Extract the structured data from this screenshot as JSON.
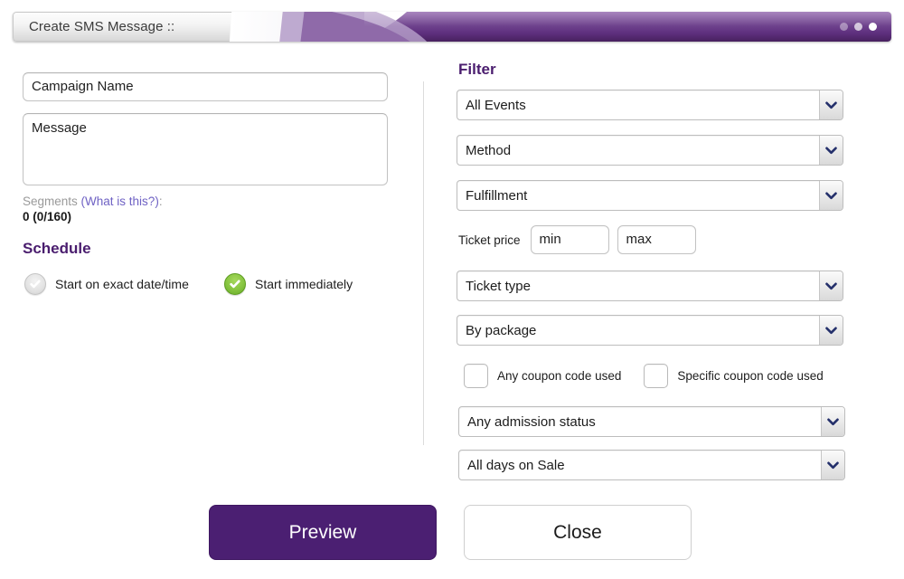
{
  "window": {
    "title": "Create SMS Message ::",
    "controls": [
      {
        "name": "minimize-dot"
      },
      {
        "name": "maximize-dot"
      },
      {
        "name": "close-dot"
      }
    ]
  },
  "colors": {
    "brand_purple": "#4b1f72",
    "title_purple_light": "#9064ac",
    "title_purple_dark": "#47215e",
    "link_purple": "#6f62c4",
    "green_selected": "#86c440",
    "muted_gray": "#9a9a9a"
  },
  "left_panel": {
    "campaign_name": {
      "value": "Campaign Name",
      "placeholder": "Campaign Name"
    },
    "message": {
      "value": "Message",
      "placeholder": "Message"
    },
    "segments": {
      "label": "Segments ",
      "link": "(What is this?)",
      "colon": ":",
      "count": "0 (0/160)"
    },
    "schedule": {
      "heading": "Schedule",
      "options": [
        {
          "label": "Start on exact date/time",
          "selected": false,
          "icon": "check-circle-gray-icon"
        },
        {
          "label": "Start immediately",
          "selected": true,
          "icon": "check-circle-green-icon"
        }
      ]
    }
  },
  "right_panel": {
    "heading": "Filter",
    "selects": [
      {
        "name": "all-events",
        "value": "All Events"
      },
      {
        "name": "method",
        "value": "Method"
      },
      {
        "name": "fulfillment",
        "value": "Fulfillment"
      },
      {
        "name": "ticket-type",
        "value": "Ticket type"
      },
      {
        "name": "by-package",
        "value": "By package"
      },
      {
        "name": "admission-status",
        "value": "Any admission status"
      },
      {
        "name": "days-on-sale",
        "value": "All days on Sale"
      }
    ],
    "ticket_price": {
      "label": "Ticket price",
      "min": {
        "value": "min",
        "placeholder": "min"
      },
      "max": {
        "value": "max",
        "placeholder": "max"
      }
    },
    "coupons": [
      {
        "label": "Any coupon code used",
        "checked": false
      },
      {
        "label": "Specific coupon code used",
        "checked": false
      }
    ]
  },
  "footer": {
    "preview_label": "Preview",
    "close_label": "Close"
  }
}
